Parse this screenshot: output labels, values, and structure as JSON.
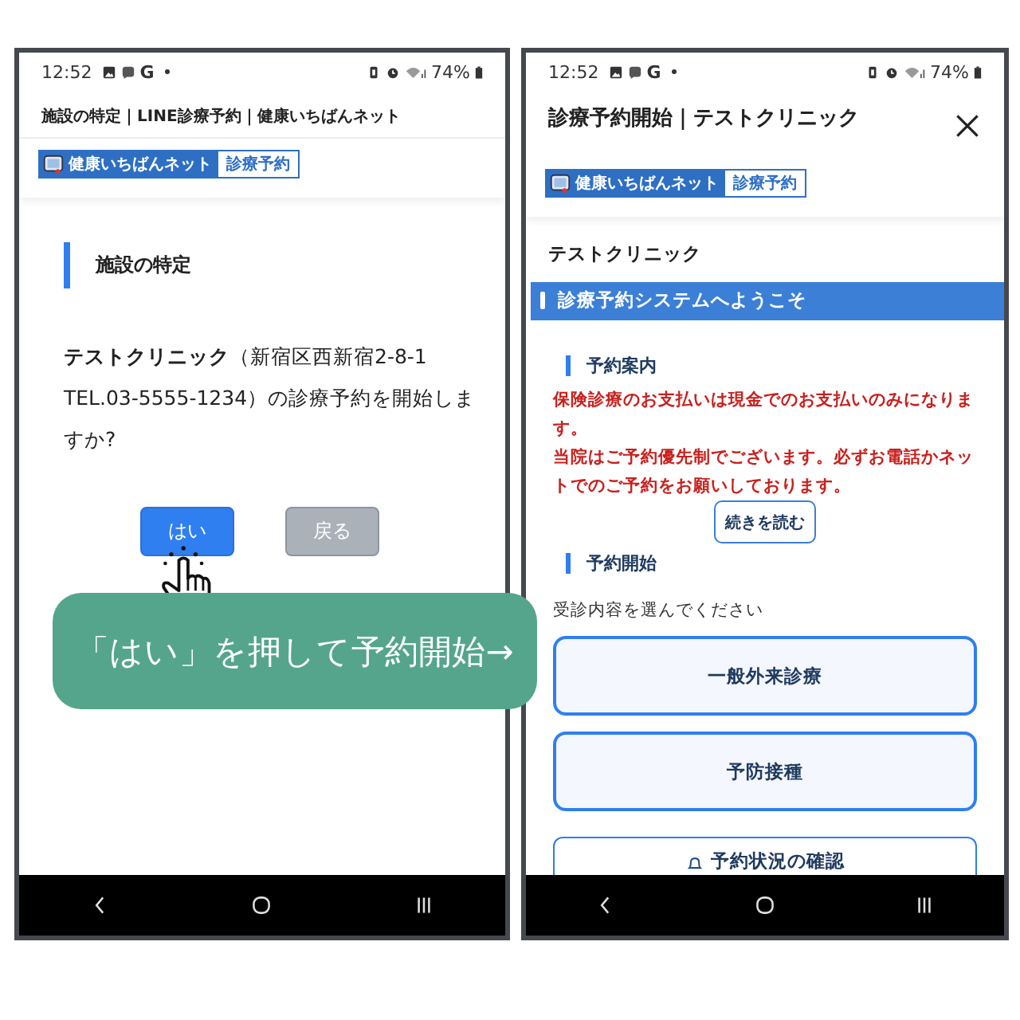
{
  "left_screen": {
    "status_bar": {
      "time": "12:52",
      "app_letter": "G",
      "battery": "74%"
    },
    "page_title": "施設の特定｜LINE診療予約｜健康いちばんネット",
    "logo": {
      "brand": "健康いちばんネット",
      "service": "診療予約"
    },
    "heading": "施設の特定",
    "message": "**テストクリニック**（新宿区西新宿2-8-1 TEL.03-5555-1234）の診療予約を開始しますか?",
    "buttons": [
      {
        "label": "はい",
        "kind": "primary"
      },
      {
        "label": "戻る",
        "kind": "secondary"
      }
    ]
  },
  "right_screen": {
    "status_bar": {
      "time": "12:52",
      "app_letter": "G",
      "battery": "74%"
    },
    "page_title": "診療予約開始｜テストクリニック",
    "logo": {
      "brand": "健康いちばんネット",
      "service": "診療予約"
    },
    "clinic_name": "テストクリニック",
    "banner": "診療予約システムへようこそ",
    "notice_heading": "予約案内",
    "notice_lines": [
      "保険診療のお支払いは現金でのお支払いのみになります。",
      "当院はご予約優先制でございます。必ずお電話かネットでのご予約をお願いしております。"
    ],
    "read_more": "続きを読む",
    "booking_heading": "予約開始",
    "prompt": "受診内容を選んでください",
    "options": [
      {
        "label": "一般外来診療",
        "kind": "option"
      },
      {
        "label": "予防接種",
        "kind": "option"
      },
      {
        "label": "予約状況の確認",
        "kind": "status"
      }
    ]
  },
  "callout": "「はい」を押して予約開始→"
}
